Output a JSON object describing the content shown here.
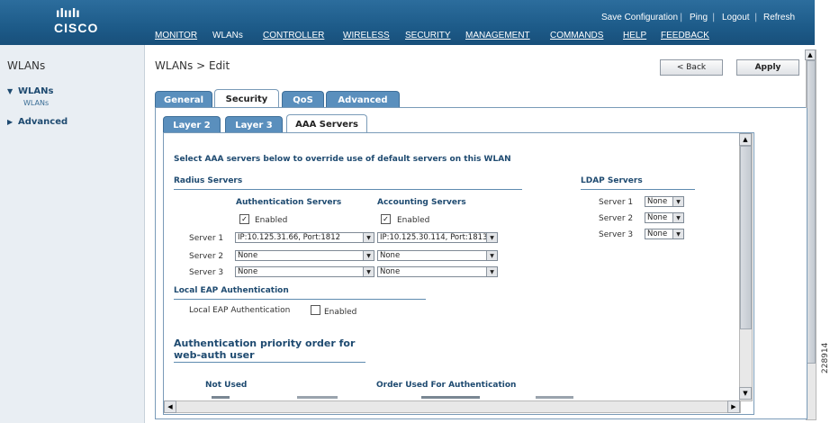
{
  "header": {
    "logo_bars": "ılıılı",
    "logo_text": "CISCO",
    "top_links": [
      "Save Configuration",
      "Ping",
      "Logout",
      "Refresh"
    ],
    "nav": [
      "MONITOR",
      "WLANs",
      "CONTROLLER",
      "WIRELESS",
      "SECURITY",
      "MANAGEMENT",
      "COMMANDS",
      "HELP",
      "FEEDBACK"
    ],
    "active_nav": "WLANs",
    "color_primary": "#1f5d8c"
  },
  "sidebar": {
    "title": "WLANs",
    "items": [
      {
        "label": "WLANs",
        "icon": "triangle-down-icon"
      },
      {
        "label": "WLANs",
        "icon": ""
      },
      {
        "label": "Advanced",
        "icon": "triangle-right-icon"
      }
    ]
  },
  "main": {
    "title": "WLANs > Edit",
    "back_label": "< Back",
    "apply_label": "Apply",
    "tabs": [
      "General",
      "Security",
      "QoS",
      "Advanced"
    ],
    "active_tab": "Security",
    "subtabs": [
      "Layer 2",
      "Layer 3",
      "AAA Servers"
    ],
    "active_subtab": "AAA Servers"
  },
  "aaa": {
    "intro": "Select AAA servers below to override use of default servers on this WLAN",
    "radius_heading": "Radius Servers",
    "auth_heading": "Authentication Servers",
    "acct_heading": "Accounting Servers",
    "enabled_label": "Enabled",
    "auth_enabled": true,
    "acct_enabled": true,
    "rows": [
      {
        "label": "Server 1",
        "auth": "IP:10.125.31.66, Port:1812",
        "acct": "IP:10.125.30.114, Port:1813"
      },
      {
        "label": "Server 2",
        "auth": "None",
        "acct": "None"
      },
      {
        "label": "Server 3",
        "auth": "None",
        "acct": "None"
      }
    ],
    "ldap_heading": "LDAP Servers",
    "ldap_rows": [
      {
        "label": "Server 1",
        "value": "None"
      },
      {
        "label": "Server 2",
        "value": "None"
      },
      {
        "label": "Server 3",
        "value": "None"
      }
    ],
    "local_eap_heading": "Local EAP Authentication",
    "local_eap_label": "Local EAP Authentication",
    "local_eap_enabled_label": "Enabled",
    "local_eap_enabled": false,
    "priority_heading_1": "Authentication priority order for",
    "priority_heading_2": "web-auth user",
    "not_used_label": "Not Used",
    "order_used_label": "Order Used For Authentication"
  },
  "watermark": "228914"
}
